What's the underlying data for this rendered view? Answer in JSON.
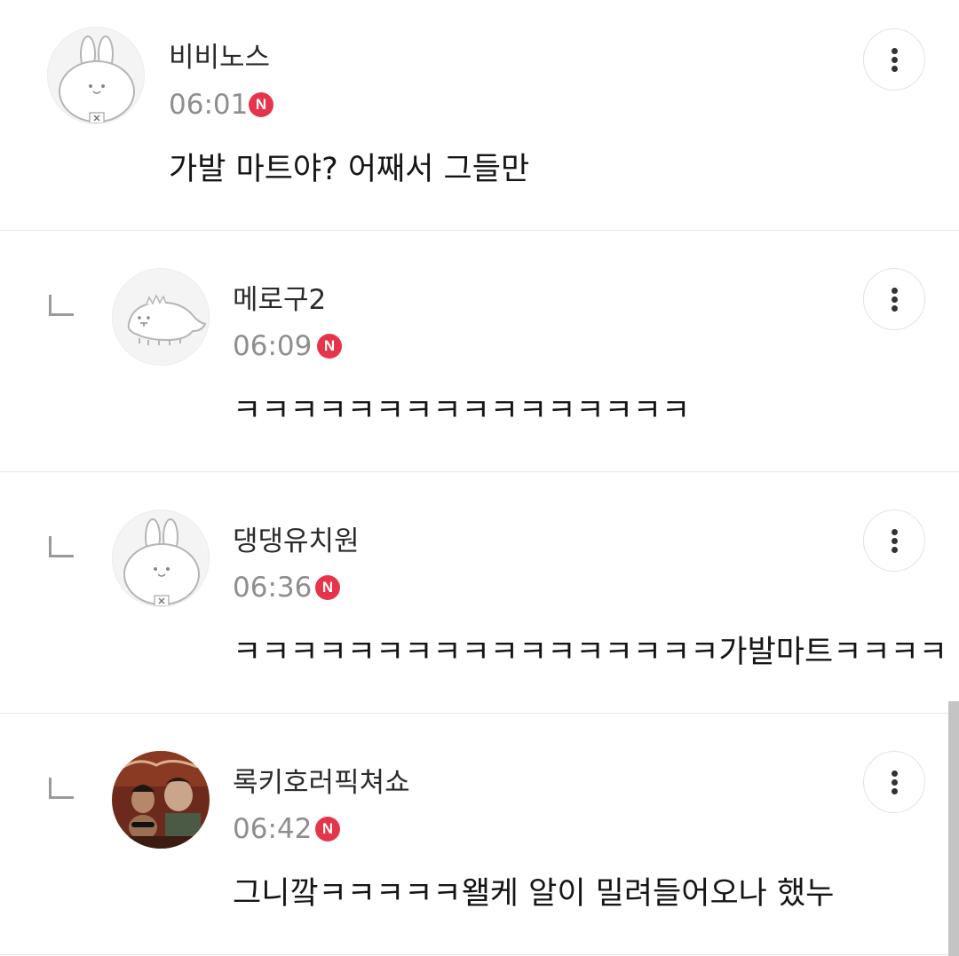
{
  "comments": [
    {
      "nickname": "비비노스",
      "time": "06:01",
      "badge": "N",
      "text": "가발 마트야? 어째서 그들만",
      "avatar": "rabbit-avatar",
      "is_reply": false
    },
    {
      "nickname": "메로구2",
      "time": "06:09",
      "badge": "N",
      "text": "ㅋㅋㅋㅋㅋㅋㅋㅋㅋㅋㅋㅋㅋㅋㅋㅋ",
      "avatar": "dinosaur-avatar",
      "is_reply": true
    },
    {
      "nickname": "댕댕유치원",
      "time": "06:36",
      "badge": "N",
      "text": "ㅋㅋㅋㅋㅋㅋㅋㅋㅋㅋㅋㅋㅋㅋㅋㅋㅋ가발마트ㅋㅋㅋㅋ",
      "avatar": "rabbit-avatar",
      "is_reply": true
    },
    {
      "nickname": "록키호러픽쳐쇼",
      "time": "06:42",
      "badge": "N",
      "text": "그니깤ㅋㅋㅋㅋㅋ왤케 알이 밀려들어오나 했누",
      "avatar": "photo-avatar",
      "is_reply": true
    }
  ],
  "icons": {
    "more": "vertical-ellipsis-icon",
    "reply": "reply-corner-icon"
  },
  "colors": {
    "badge": "#e6344a",
    "time": "#8e8e8e",
    "divider": "#e6e6e6"
  }
}
